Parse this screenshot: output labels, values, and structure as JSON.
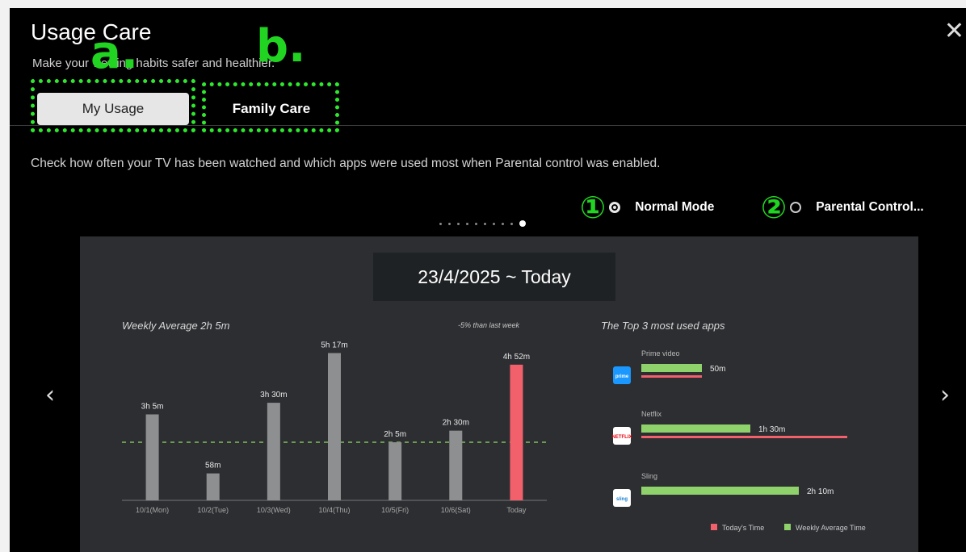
{
  "header": {
    "title": "Usage Care",
    "subtitle": "Make your viewing habits safer and healthier.",
    "close_icon": "✕"
  },
  "annotations": {
    "a": "a.",
    "b": "b.",
    "one": "①",
    "two": "②"
  },
  "tabs": [
    {
      "label": "My Usage",
      "active": true
    },
    {
      "label": "Family Care",
      "active": false
    }
  ],
  "description": "Check how often your TV has been watched and which apps were used most when Parental control was enabled.",
  "modes": [
    {
      "label": "Normal Mode",
      "selected": true
    },
    {
      "label": "Parental Control...",
      "selected": false
    }
  ],
  "pager": {
    "count": 10,
    "current": 10
  },
  "panel": {
    "date_range": "23/4/2025 ~ Today",
    "weekly_average": "Weekly Average 2h 5m",
    "compare": "-5% than last week",
    "top3_title": "The Top 3 most used apps"
  },
  "colors": {
    "bar_gray": "#8e8f91",
    "bar_today": "#f2606b",
    "green": "#8fd16b",
    "avg_line": "#7fbf5a",
    "accent_annotation": "#22d422"
  },
  "chart_data": [
    {
      "type": "bar",
      "categories": [
        "10/1(Mon)",
        "10/2(Tue)",
        "10/3(Wed)",
        "10/4(Thu)",
        "10/5(Fri)",
        "10/6(Sat)",
        "Today"
      ],
      "values": [
        185,
        58,
        210,
        317,
        125,
        150,
        292
      ],
      "data_labels": [
        "3h 5m",
        "58m",
        "3h 30m",
        "5h 17m",
        "2h 5m",
        "2h 30m",
        "4h 52m"
      ],
      "average_line": 125,
      "ylim": [
        0,
        330
      ]
    },
    {
      "type": "bar",
      "orientation": "horizontal",
      "categories": [
        "Prime video",
        "Netflix",
        "Sling"
      ],
      "series": [
        {
          "name": "Weekly Average Time",
          "values": [
            50,
            90,
            130
          ],
          "labels": [
            "50m",
            "1h 30m",
            "2h 10m"
          ]
        },
        {
          "name": "Today's Time",
          "values": [
            50,
            170,
            0
          ]
        }
      ],
      "legend": [
        "Today's Time",
        "Weekly Average Time"
      ],
      "legend_position": "bottom-right"
    }
  ],
  "apps": [
    {
      "name": "Prime video",
      "icon": "prime-video-icon",
      "icon_color": "#1a98ff",
      "icon_text": "prime"
    },
    {
      "name": "Netflix",
      "icon": "netflix-icon",
      "icon_color": "#ffffff",
      "icon_text": "NETFLIX"
    },
    {
      "name": "Sling",
      "icon": "sling-icon",
      "icon_color": "#ffffff",
      "icon_text": "sling"
    }
  ],
  "nav": {
    "prev": "‹",
    "next": "›"
  }
}
